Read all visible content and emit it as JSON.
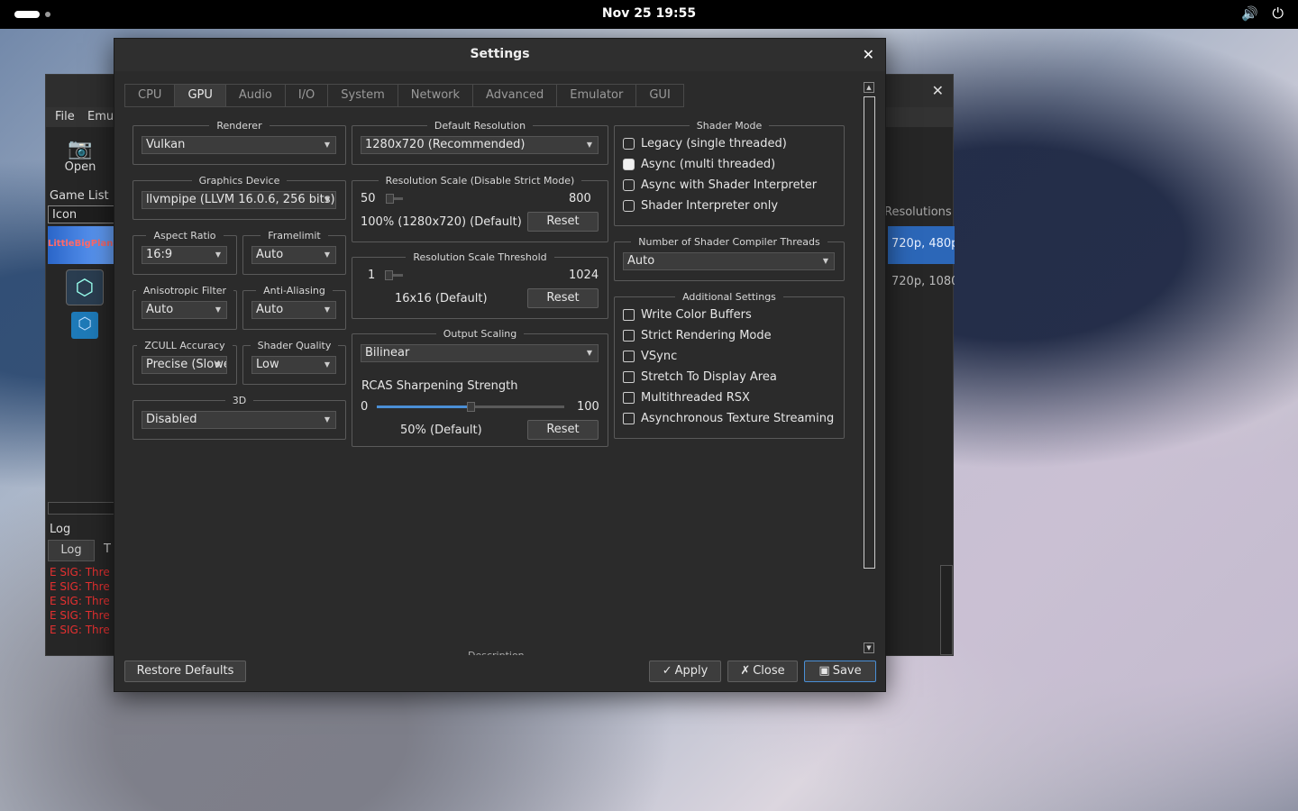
{
  "topbar": {
    "clock": "Nov 25  19:55",
    "volume_icon": "volume-icon",
    "power_icon": "power-icon"
  },
  "mainwin": {
    "menu": [
      "File",
      "Emu"
    ],
    "open_label": "Open",
    "game_list_label": "Game List",
    "icon_col": "Icon",
    "thumb1_text": "LittleBigPlanet",
    "resolutions_hdr": "Resolutions",
    "res_row1": "720p, 480p",
    "res_row2": "720p, 1080",
    "log_label": "Log",
    "log_tab": "Log",
    "log_tab2": "T",
    "log_lines": [
      "E SIG: Thre",
      "E SIG: Thre",
      "E SIG: Thre",
      "E SIG: Thre",
      "E SIG: Thre"
    ]
  },
  "dialog": {
    "title": "Settings",
    "tabs": [
      "CPU",
      "GPU",
      "Audio",
      "I/O",
      "System",
      "Network",
      "Advanced",
      "Emulator",
      "GUI"
    ],
    "renderer": {
      "legend": "Renderer",
      "value": "Vulkan"
    },
    "graphics_device": {
      "legend": "Graphics Device",
      "value": "llvmpipe (LLVM 16.0.6, 256 bits)"
    },
    "aspect_ratio": {
      "legend": "Aspect Ratio",
      "value": "16:9"
    },
    "framelimit": {
      "legend": "Framelimit",
      "value": "Auto"
    },
    "anisotropic": {
      "legend": "Anisotropic Filter",
      "value": "Auto"
    },
    "anti_aliasing": {
      "legend": "Anti-Aliasing",
      "value": "Auto"
    },
    "zcull": {
      "legend": "ZCULL Accuracy",
      "value": "Precise (Slowest)"
    },
    "shader_quality": {
      "legend": "Shader Quality",
      "value": "Low"
    },
    "three_d": {
      "legend": "3D",
      "value": "Disabled"
    },
    "default_resolution": {
      "legend": "Default Resolution",
      "value": "1280x720 (Recommended)"
    },
    "res_scale": {
      "legend": "Resolution Scale (Disable Strict Mode)",
      "min": "50",
      "max": "800",
      "level": 0.05,
      "status": "100% (1280x720) (Default)",
      "reset": "Reset"
    },
    "res_threshold": {
      "legend": "Resolution Scale Threshold",
      "min": "1",
      "max": "1024",
      "level": 0.0,
      "status": "16x16 (Default)",
      "reset": "Reset"
    },
    "output_scaling": {
      "legend": "Output Scaling",
      "value": "Bilinear",
      "rcas_label": "RCAS Sharpening Strength",
      "min": "0",
      "max": "100",
      "level": 0.5,
      "status": "50% (Default)",
      "reset": "Reset"
    },
    "shader_mode": {
      "legend": "Shader Mode",
      "options": [
        {
          "label": "Legacy (single threaded)",
          "checked": false
        },
        {
          "label": "Async (multi threaded)",
          "checked": true
        },
        {
          "label": "Async with Shader Interpreter",
          "checked": false
        },
        {
          "label": "Shader Interpreter only",
          "checked": false
        }
      ]
    },
    "compiler_threads": {
      "legend": "Number of Shader Compiler Threads",
      "value": "Auto"
    },
    "additional": {
      "legend": "Additional Settings",
      "options": [
        {
          "label": "Write Color Buffers",
          "checked": false
        },
        {
          "label": "Strict Rendering Mode",
          "checked": false
        },
        {
          "label": "VSync",
          "checked": false
        },
        {
          "label": "Stretch To Display Area",
          "checked": false
        },
        {
          "label": "Multithreaded RSX",
          "checked": false
        },
        {
          "label": "Asynchronous Texture Streaming",
          "checked": false
        }
      ]
    },
    "description_cut": "Description",
    "footer": {
      "restore": "Restore Defaults",
      "apply": "Apply",
      "close": "Close",
      "save": "Save"
    },
    "accent_color": "#4a8fd6"
  }
}
